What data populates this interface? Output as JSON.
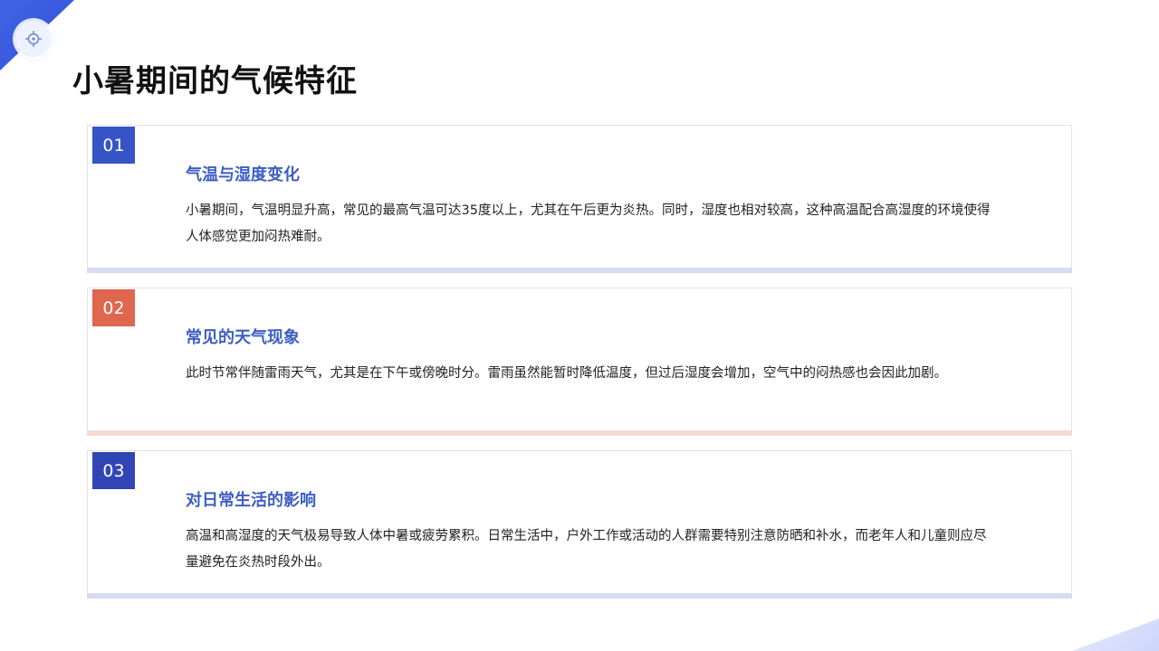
{
  "title": "小暑期间的气候特征",
  "colors": {
    "blue": "#3554c8",
    "red": "#e06650",
    "heading_blue": "#3d5ec2",
    "heading_red": "#3d5ec2",
    "bar_blue": "#d6dcf5",
    "bar_red": "#f7d9d4"
  },
  "logo": {
    "icon": "target-icon"
  },
  "cards": [
    {
      "number": "01",
      "heading": "气温与湿度变化",
      "body": "小暑期间，气温明显升高，常见的最高气温可达35度以上，尤其在午后更为炎热。同时，湿度也相对较高，这种高温配合高湿度的环境使得人体感觉更加闷热难耐。"
    },
    {
      "number": "02",
      "heading": "常见的天气现象",
      "body": "此时节常伴随雷雨天气，尤其是在下午或傍晚时分。雷雨虽然能暂时降低温度，但过后湿度会增加，空气中的闷热感也会因此加剧。"
    },
    {
      "number": "03",
      "heading": "对日常生活的影响",
      "body": "高温和高湿度的天气极易导致人体中暑或疲劳累积。日常生活中，户外工作或活动的人群需要特别注意防晒和补水，而老年人和儿童则应尽量避免在炎热时段外出。"
    }
  ]
}
